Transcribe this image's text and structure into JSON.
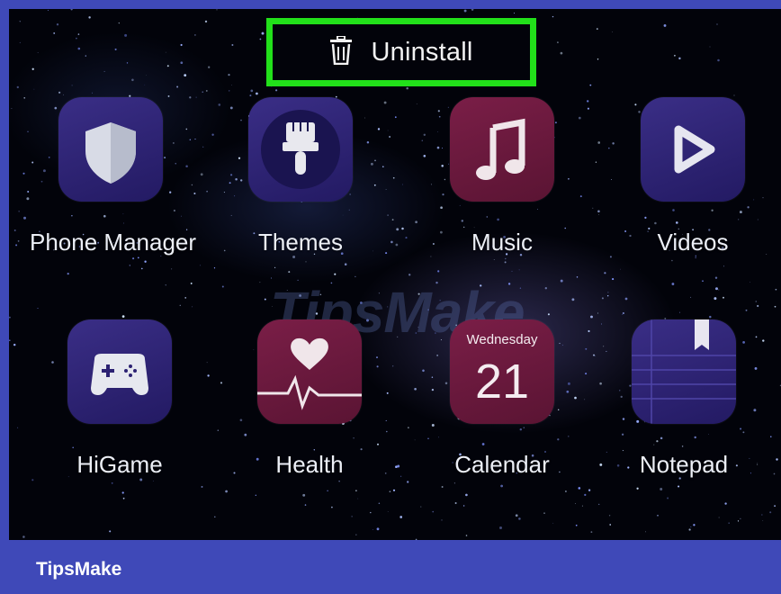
{
  "top_action": {
    "label": "Uninstall",
    "icon": "trash-icon",
    "highlight_color": "#22e01a"
  },
  "apps": [
    {
      "label": "Phone Manager",
      "icon": "shield-icon"
    },
    {
      "label": "Themes",
      "icon": "paintbrush-icon"
    },
    {
      "label": "Music",
      "icon": "music-note-icon"
    },
    {
      "label": "Videos",
      "icon": "play-icon"
    },
    {
      "label": "HiGame",
      "icon": "gamepad-icon"
    },
    {
      "label": "Health",
      "icon": "heart-pulse-icon"
    },
    {
      "label": "Calendar",
      "icon": "calendar-icon",
      "weekday": "Wednesday",
      "day": "21"
    },
    {
      "label": "Notepad",
      "icon": "notepad-icon"
    }
  ],
  "watermark": "TipsMake",
  "footer": {
    "brand": "TipsMake"
  },
  "colors": {
    "frame": "#3f49b8",
    "screen": "#02030a",
    "icon_blue": "#2c2273",
    "icon_red": "#6a1a3d"
  }
}
